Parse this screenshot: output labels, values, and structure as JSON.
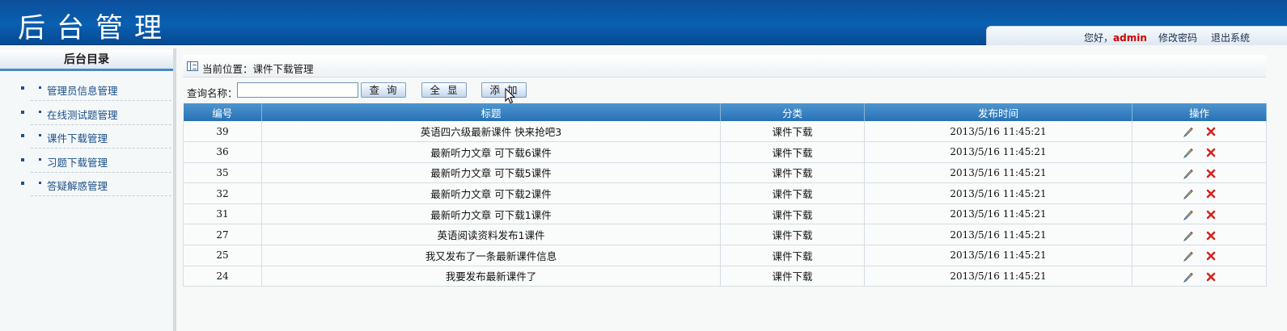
{
  "header": {
    "app_title": "后台管理",
    "greeting_prefix": "您好，",
    "username": "admin",
    "change_password": "修改密码",
    "logout": "退出系统"
  },
  "sidebar": {
    "title": "后台目录",
    "items": [
      {
        "label": "管理员信息管理"
      },
      {
        "label": "在线测试题管理"
      },
      {
        "label": "课件下载管理"
      },
      {
        "label": "习题下载管理"
      },
      {
        "label": "答疑解惑管理"
      }
    ]
  },
  "main": {
    "breadcrumb": "当前位置：课件下载管理",
    "search": {
      "label": "查询名称：",
      "value": "",
      "placeholder": ""
    },
    "buttons": {
      "query": "查询",
      "show_all": "全显",
      "add": "添加"
    },
    "table": {
      "columns": [
        "编号",
        "标题",
        "分类",
        "发布时间",
        "操作"
      ],
      "rows": [
        {
          "id": "39",
          "title": "英语四六级最新课件 快来抢吧3",
          "category": "课件下载",
          "time": "2013/5/16 11:45:21"
        },
        {
          "id": "36",
          "title": "最新听力文章 可下载6课件",
          "category": "课件下载",
          "time": "2013/5/16 11:45:21"
        },
        {
          "id": "35",
          "title": "最新听力文章 可下载5课件",
          "category": "课件下载",
          "time": "2013/5/16 11:45:21"
        },
        {
          "id": "32",
          "title": "最新听力文章 可下载2课件",
          "category": "课件下载",
          "time": "2013/5/16 11:45:21"
        },
        {
          "id": "31",
          "title": "最新听力文章 可下载1课件",
          "category": "课件下载",
          "time": "2013/5/16 11:45:21"
        },
        {
          "id": "27",
          "title": "英语阅读资料发布1课件",
          "category": "课件下载",
          "time": "2013/5/16 11:45:21"
        },
        {
          "id": "25",
          "title": "我又发布了一条最新课件信息",
          "category": "课件下载",
          "time": "2013/5/16 11:45:21"
        },
        {
          "id": "24",
          "title": "我要发布最新课件了",
          "category": "课件下载",
          "time": "2013/5/16 11:45:21"
        }
      ]
    }
  },
  "icons": {
    "edit": "pencil-icon",
    "delete": "delete-x-icon",
    "breadcrumb": "list-icon"
  },
  "colors": {
    "header_blue": "#0a5fb0",
    "table_header": "#2f7bbd",
    "admin_red": "#d10000",
    "link_blue": "#1a4f8b"
  }
}
